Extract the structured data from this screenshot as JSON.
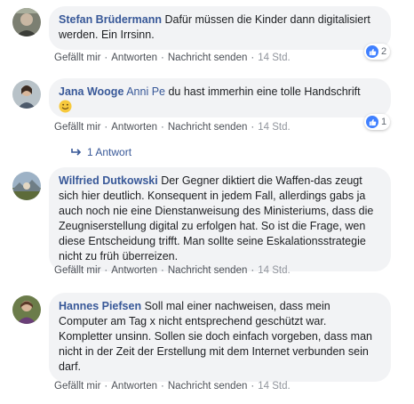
{
  "comments": [
    {
      "author": "Stefan Brüdermann",
      "text": "Dafür müssen die Kinder dann digitalisiert werden. Ein Irrsinn.",
      "reactions": "2",
      "actions": {
        "like": "Gefällt mir",
        "reply": "Antworten",
        "message": "Nachricht senden",
        "time": "14 Std."
      }
    },
    {
      "author": "Jana Wooge",
      "mention": "Anni Pe",
      "text": "du hast immerhin eine tolle Handschrift",
      "emoji": "smiley-emoji",
      "reactions": "1",
      "actions": {
        "like": "Gefällt mir",
        "reply": "Antworten",
        "message": "Nachricht senden",
        "time": "14 Std."
      },
      "replies_label": "1 Antwort"
    },
    {
      "author": "Wilfried Dutkowski",
      "text": "Der Gegner diktiert die Waffen-das zeugt sich hier deutlich. Konsequent in jedem Fall, allerdings gabs ja auch noch nie eine Dienstanweisung des Ministeriums, dass die Zeugniserstellung digital zu erfolgen hat. So ist die Frage, wen diese Entscheidung trifft. Man sollte seine Eskalationsstrategie nicht zu früh überreizen.",
      "actions": {
        "like": "Gefällt mir",
        "reply": "Antworten",
        "message": "Nachricht senden",
        "time": "14 Std."
      }
    },
    {
      "author": "Hannes Piefsen",
      "text": "Soll mal einer nachweisen, dass mein Computer am Tag x nicht entsprechend geschützt war. Kompletter unsinn. Sollen sie doch einfach vorgeben, dass man nicht in der Zeit der Erstellung mit dem Internet verbunden sein darf.",
      "actions": {
        "like": "Gefällt mir",
        "reply": "Antworten",
        "message": "Nachricht senden",
        "time": "14 Std."
      }
    }
  ],
  "colors": {
    "link": "#385898",
    "bubble": "#f2f3f5",
    "like": "#4080ff",
    "meta": "#606770"
  }
}
